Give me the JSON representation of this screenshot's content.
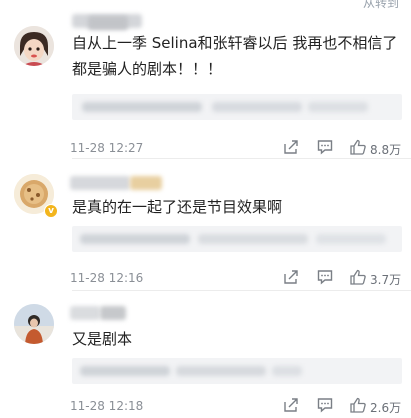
{
  "top_link": "从转到",
  "comments": [
    {
      "text_lines": [
        "自从上一季 Selina和张轩睿以后 我再也不相信了",
        "都是骗人的剧本！！！"
      ],
      "timestamp": "11-28 12:27",
      "likes": "8.8万"
    },
    {
      "text_lines": [
        "是真的在一起了还是节目效果啊"
      ],
      "timestamp": "11-28 12:16",
      "likes": "3.7万"
    },
    {
      "text_lines": [
        "又是剧本"
      ],
      "timestamp": "11-28 12:18",
      "likes": "2.6万"
    }
  ],
  "icons": [
    "share-icon",
    "comment-icon",
    "like-icon",
    "verified-badge-icon"
  ]
}
